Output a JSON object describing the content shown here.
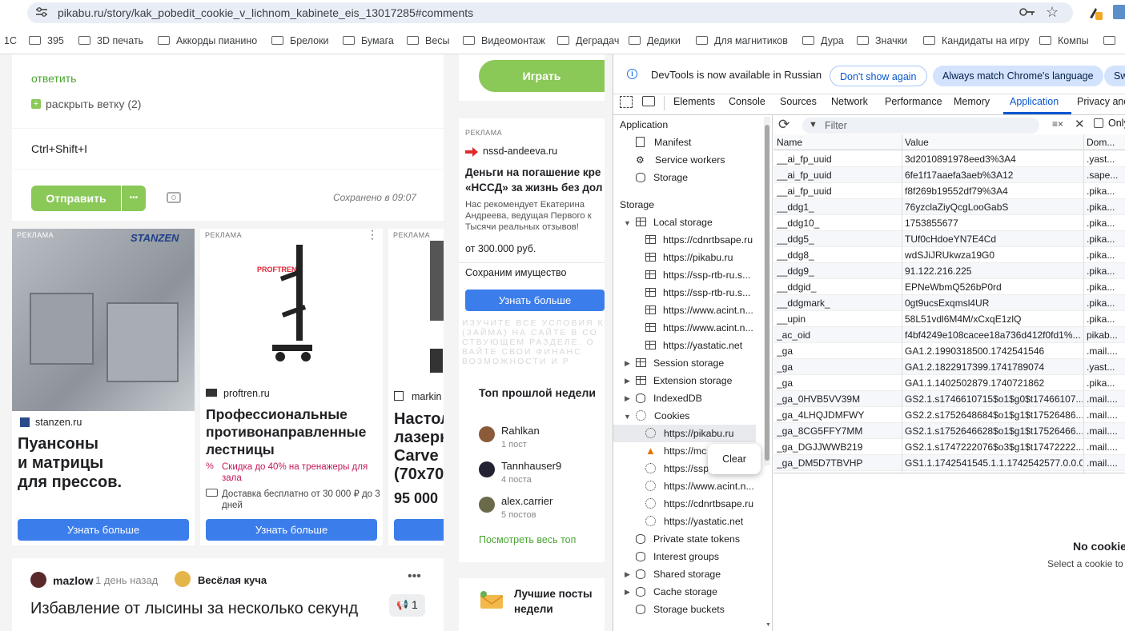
{
  "browser": {
    "url": "pikabu.ru/story/kak_pobedit_cookie_v_lichnom_kabinete_eis_13017285#comments",
    "bookmarks": [
      "1С",
      "395",
      "3D печать",
      "Аккорды пианино",
      "Брелоки",
      "Бумага",
      "Весы",
      "Видеомонтаж",
      "Деградач",
      "Дедики",
      "Для магнитиков",
      "Дура",
      "Значки",
      "Кандидаты на игру",
      "Компы"
    ]
  },
  "page": {
    "reply_link": "ответить",
    "expand_thread": "раскрыть ветку (2)",
    "comment_text": "Ctrl+Shift+I",
    "send_button": "Отправить",
    "send_more": "•••",
    "saved_status": "Сохранено в 09:07",
    "ads": [
      {
        "tag": "РЕКЛАМА",
        "brand": "STANZEN",
        "domain": "stanzen.ru",
        "title": "Пуансоны\nи матрицы\nдля прессов.",
        "button": "Узнать больше"
      },
      {
        "tag": "РЕКЛАМА",
        "brand": "PROFTREN",
        "domain": "proftren.ru",
        "title": "Профессиональные противонаправленные лестницы",
        "promo": "Скидка до 40% на тренажеры для зала",
        "delivery": "Доставка бесплатно от 30 000 ₽ до 3 дней",
        "button": "Узнать больше"
      },
      {
        "tag": "РЕКЛАМА",
        "domain": "markin",
        "title": "Настол\nлазерн\nCarve I\n(70x70",
        "price": "95 000",
        "button": "Узнать больше"
      }
    ],
    "post": {
      "author": "mazlow",
      "time": "1 день назад",
      "community": "Весёлая куча",
      "title": "Избавление от лысины за несколько секунд",
      "rating": "1"
    }
  },
  "sidebar": {
    "play_button": "Играть",
    "ad": {
      "tag": "РЕКЛАМА",
      "domain": "nssd-andeeva.ru",
      "title": "Деньги на погашение кре «НССД» за жизнь без дол",
      "body": "Нас рекомендует Екатерина Андреева, ведущая Первого к Тысячи реальных отзывов!",
      "price": "от 300.000 руб.",
      "slogan": "Сохраним имущество",
      "button": "Узнать больше",
      "fine": "ИЗУЧИТЕ ВСЕ УСЛОВИЯ К (ЗАЙМА) НА САЙТЕ В СО СТВУЮЩЕМ РАЗДЕЛЕ. О ВАЙТЕ СВОИ ФИНАНС ВОЗМОЖНОСТИ И Р"
    },
    "top_week": {
      "title": "Топ прошлой недели",
      "users": [
        {
          "name": "Rahlkan",
          "posts": "1 пост"
        },
        {
          "name": "Tannhauser9",
          "posts": "4 поста"
        },
        {
          "name": "alex.carrier",
          "posts": "5 постов"
        }
      ],
      "link": "Посмотреть весь топ"
    },
    "best_posts": "Лучшие посты недели"
  },
  "devtools": {
    "notice": "DevTools is now available in Russian",
    "btn_dont_show": "Don't show again",
    "btn_always_match": "Always match Chrome's language",
    "btn_switch": "Sw",
    "tabs": [
      "Elements",
      "Console",
      "Sources",
      "Network",
      "Performance",
      "Memory",
      "Application",
      "Privacy and"
    ],
    "active_tab": "Application",
    "filter_placeholder": "Filter",
    "only_label": "Only",
    "tree": {
      "application_header": "Application",
      "application_items": [
        "Manifest",
        "Service workers",
        "Storage"
      ],
      "storage_header": "Storage",
      "local_storage": "Local storage",
      "local_items": [
        "https://cdnrtbsape.ru",
        "https://pikabu.ru",
        "https://ssp-rtb-ru.s...",
        "https://ssp-rtb-ru.s...",
        "https://www.acint.n...",
        "https://www.acint.n...",
        "https://yastatic.net"
      ],
      "session_storage": "Session storage",
      "extension_storage": "Extension storage",
      "indexeddb": "IndexedDB",
      "cookies": "Cookies",
      "cookie_items": [
        "https://pikabu.ru",
        "https://mc",
        "https://ssp",
        "https://www.acint.n...",
        "https://cdnrtbsape.ru",
        "https://yastatic.net"
      ],
      "other_items": [
        "Private state tokens",
        "Interest groups",
        "Shared storage",
        "Cache storage",
        "Storage buckets"
      ]
    },
    "context_menu": "Clear",
    "table": {
      "headers": [
        "Name",
        "Value",
        "Dom..."
      ],
      "rows": [
        [
          "__ai_fp_uuid",
          "3d2010891978eed3%3A4",
          ".yast..."
        ],
        [
          "__ai_fp_uuid",
          "6fe1f17aaefa3aeb%3A12",
          ".sape..."
        ],
        [
          "__ai_fp_uuid",
          "f8f269b19552df79%3A4",
          ".pika..."
        ],
        [
          "__ddg1_",
          "76yzclaZiyQcgLooGabS",
          ".pika..."
        ],
        [
          "__ddg10_",
          "1753855677",
          ".pika..."
        ],
        [
          "__ddg5_",
          "TUf0cHdoeYN7E4Cd",
          ".pika..."
        ],
        [
          "__ddg8_",
          "wdSJiJRUkwza19G0",
          ".pika..."
        ],
        [
          "__ddg9_",
          "91.122.216.225",
          ".pika..."
        ],
        [
          "__ddgid_",
          "EPNeWbmQ526bP0rd",
          ".pika..."
        ],
        [
          "__ddgmark_",
          "0gt9ucsExqmsl4UR",
          ".pika..."
        ],
        [
          "__upin",
          "58L51vdl6M4M/xCxqE1zlQ",
          ".pika..."
        ],
        [
          "_ac_oid",
          "f4bf4249e108cacee18a736d412f0fd1%...",
          "pikab..."
        ],
        [
          "_ga",
          "GA1.2.1990318500.1742541546",
          ".mail...."
        ],
        [
          "_ga",
          "GA1.2.1822917399.1741789074",
          ".yast..."
        ],
        [
          "_ga",
          "GA1.1.1402502879.1740721862",
          ".pika..."
        ],
        [
          "_ga_0HVB5VV39M",
          "GS2.1.s1746610715$o1$g0$t17466107...",
          ".mail...."
        ],
        [
          "_ga_4LHQJDMFWY",
          "GS2.2.s1752648684$o1$g1$t17526486...",
          ".mail...."
        ],
        [
          "_ga_8CG5FFY7MM",
          "GS2.1.s1752646628$o1$g1$t17526466...",
          ".mail...."
        ],
        [
          "_ga_DGJJWWB219",
          "GS2.1.s1747222076$o3$g1$t17472222...",
          ".mail...."
        ],
        [
          "_ga_DM5D7TBVHP",
          "GS1.1.1742541545.1.1.1742542577.0.0.0",
          ".mail...."
        ]
      ]
    },
    "no_cookie_title": "No cookie",
    "no_cookie_hint": "Select a cookie to"
  },
  "colors": {
    "accent_blue": "#1a73e8",
    "pikabu_green": "#8ac858",
    "ad_blue": "#3c7dec"
  }
}
